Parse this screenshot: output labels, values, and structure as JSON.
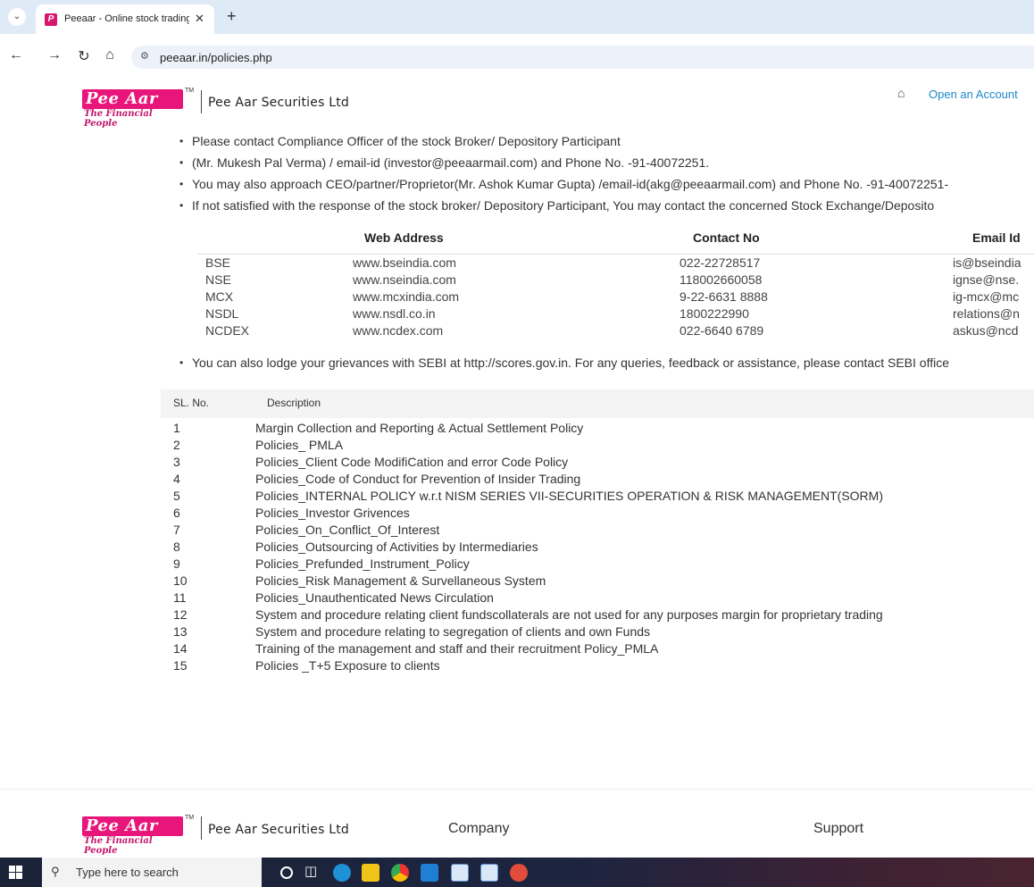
{
  "browser": {
    "tab_title": "Peeaar - Online stock trading a",
    "url": "peeaar.in/policies.php"
  },
  "header": {
    "logo_text": "Pee Aar",
    "logo_tagline": "The Financial People",
    "brand_name": "Pee Aar Securities Ltd",
    "open_account": "Open an Account"
  },
  "bullets": [
    "Please contact Compliance Officer of the stock Broker/ Depository Participant",
    "(Mr. Mukesh Pal Verma) / email-id (investor@peeaarmail.com) and Phone No. -91-40072251.",
    "You may also approach CEO/partner/Proprietor(Mr. Ashok Kumar Gupta) /email-id(akg@peeaarmail.com) and Phone No. -91-40072251-",
    "If not satisfied with the response of the stock broker/ Depository Participant, You may contact the concerned Stock Exchange/Deposito"
  ],
  "exchange_table": {
    "headers": [
      "Web Address",
      "Contact No",
      "Email Id"
    ],
    "rows": [
      [
        "BSE",
        "www.bseindia.com",
        "022-22728517",
        "is@bseindia"
      ],
      [
        "NSE",
        "www.nseindia.com",
        "118002660058",
        "ignse@nse."
      ],
      [
        "MCX",
        "www.mcxindia.com",
        "9-22-6631 8888",
        "ig-mcx@mc"
      ],
      [
        "NSDL",
        "www.nsdl.co.in",
        "1800222990",
        "relations@n"
      ],
      [
        "NCDEX",
        "www.ncdex.com",
        "022-6640 6789",
        "askus@ncd"
      ]
    ]
  },
  "sebi_note": "You can also lodge your grievances with SEBI at http://scores.gov.in. For any queries, feedback or assistance, please contact SEBI office",
  "policy_table": {
    "headers": [
      "SL. No.",
      "Description"
    ],
    "rows": [
      [
        "1",
        "Margin Collection and Reporting & Actual Settlement Policy"
      ],
      [
        "2",
        "Policies_ PMLA"
      ],
      [
        "3",
        "Policies_Client Code ModifiCation and error Code Policy"
      ],
      [
        "4",
        "Policies_Code of Conduct for Prevention of Insider Trading"
      ],
      [
        "5",
        "Policies_INTERNAL POLICY w.r.t NISM SERIES VII-SECURITIES OPERATION & RISK MANAGEMENT(SORM)"
      ],
      [
        "6",
        "Policies_Investor Grivences"
      ],
      [
        "7",
        "Policies_On_Conflict_Of_Interest"
      ],
      [
        "8",
        "Policies_Outsourcing of Activities by Intermediaries"
      ],
      [
        "9",
        "Policies_Prefunded_Instrument_Policy"
      ],
      [
        "10",
        "Policies_Risk Management & Survellaneous System"
      ],
      [
        "11",
        "Policies_Unauthenticated News Circulation"
      ],
      [
        "12",
        "System and procedure relating client fundscollaterals are not used for any purposes margin for proprietary trading"
      ],
      [
        "13",
        "System and procedure relating to segregation of clients and own Funds"
      ],
      [
        "14",
        "Training of the management and staff and their recruitment Policy_PMLA"
      ],
      [
        "15",
        "Policies _T+5 Exposure to clients"
      ]
    ]
  },
  "footer": {
    "brand_name": "Pee Aar Securities Ltd",
    "company": "Company",
    "support": "Support"
  },
  "taskbar": {
    "search_placeholder": "Type here to search"
  }
}
